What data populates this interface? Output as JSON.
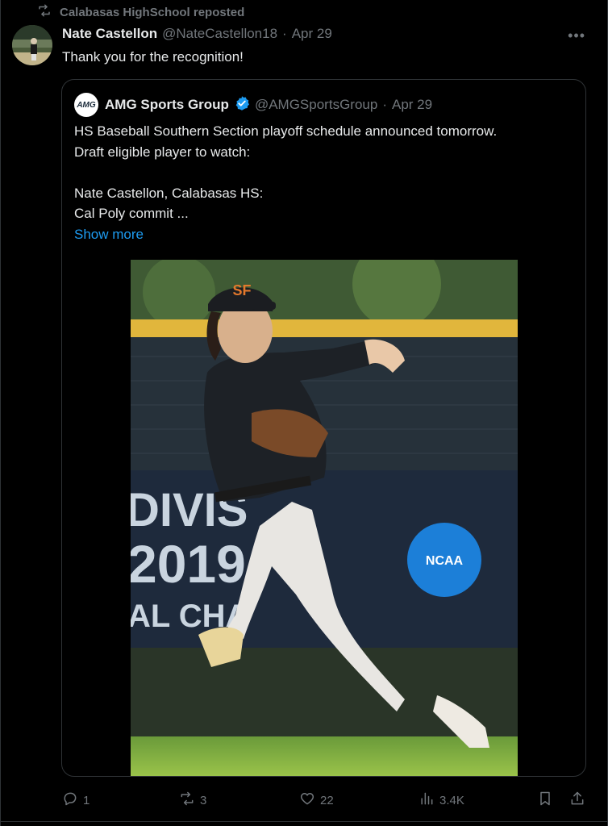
{
  "repost": {
    "text": "Calabasas HighSchool reposted"
  },
  "tweet": {
    "name": "Nate Castellon",
    "handle": "@NateCastellon18",
    "sep": "·",
    "date": "Apr 29",
    "text": "Thank you for the recognition!"
  },
  "quote": {
    "logo_text": "AMG",
    "name": "AMG Sports Group",
    "handle": "@AMGSportsGroup",
    "sep": "·",
    "date": "Apr 29",
    "lines": [
      "HS Baseball Southern Section playoff schedule announced tomorrow.",
      "Draft eligible player to watch:",
      "",
      "Nate Castellon, Calabasas HS:",
      "Cal Poly commit ..."
    ],
    "show_more": "Show more",
    "media_banner": [
      "DIVIS",
      "2019",
      "AL CHA"
    ],
    "media_badge": "NCAA"
  },
  "actions": {
    "replies": "1",
    "reposts": "3",
    "likes": "22",
    "views": "3.4K"
  },
  "colors": {
    "background": "#000000",
    "text": "#e7e9ea",
    "muted": "#71767b",
    "link": "#1d9bf0",
    "verified": "#1d9bf0",
    "border": "#2f3336"
  }
}
